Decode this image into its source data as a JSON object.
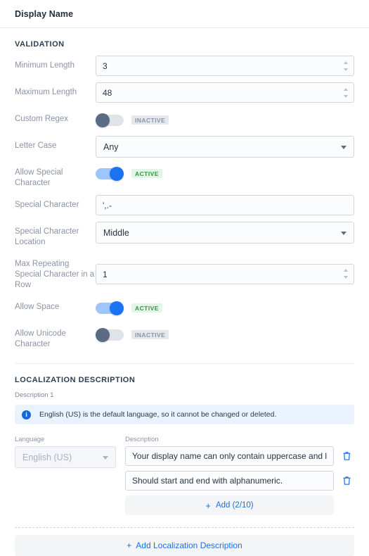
{
  "header": {
    "title": "Display Name"
  },
  "validation": {
    "section_title": "VALIDATION",
    "fields": {
      "minimum_length": {
        "label": "Minimum Length",
        "value": "3"
      },
      "maximum_length": {
        "label": "Maximum Length",
        "value": "48"
      },
      "custom_regex": {
        "label": "Custom Regex",
        "state": "off",
        "badge": "INACTIVE"
      },
      "letter_case": {
        "label": "Letter Case",
        "value": "Any"
      },
      "allow_special_character": {
        "label": "Allow Special Character",
        "state": "on",
        "badge": "ACTIVE"
      },
      "special_character": {
        "label": "Special Character",
        "value": "',.-"
      },
      "special_character_location": {
        "label": "Special Character Location",
        "value": "Middle"
      },
      "max_repeating_special_character": {
        "label": "Max Repeating Special Character in a Row",
        "value": "1"
      },
      "allow_space": {
        "label": "Allow Space",
        "state": "on",
        "badge": "ACTIVE"
      },
      "allow_unicode_character": {
        "label": "Allow Unicode Character",
        "state": "off",
        "badge": "INACTIVE"
      }
    }
  },
  "localization": {
    "section_title": "LOCALIZATION DESCRIPTION",
    "description_group_label": "Description 1",
    "info_icon": "info-circle-icon",
    "info_message": "English (US) is the default language, so it cannot be changed or deleted.",
    "language_caption": "Language",
    "language_value": "English (US)",
    "description_caption": "Description",
    "descriptions": [
      {
        "value": "Your display name can only contain uppercase and lowercase letters, numbers and special characters.",
        "delete_icon": "trash-icon"
      },
      {
        "value": "Should start and end with alphanumeric.",
        "delete_icon": "trash-icon"
      }
    ],
    "add_description_label": "Add (2/10)",
    "add_localization_label": "Add Localization Description",
    "plus_glyph": "+"
  },
  "colors": {
    "accent": "#1b6fe0",
    "toggle_on_knob": "#1b73f2",
    "toggle_on_track": "#9ec6fb",
    "toggle_off_knob": "#5c6b84",
    "badge_active_text": "#2e9a44",
    "badge_inactive_text": "#8994a5",
    "info_bg": "#eaf3fd"
  }
}
